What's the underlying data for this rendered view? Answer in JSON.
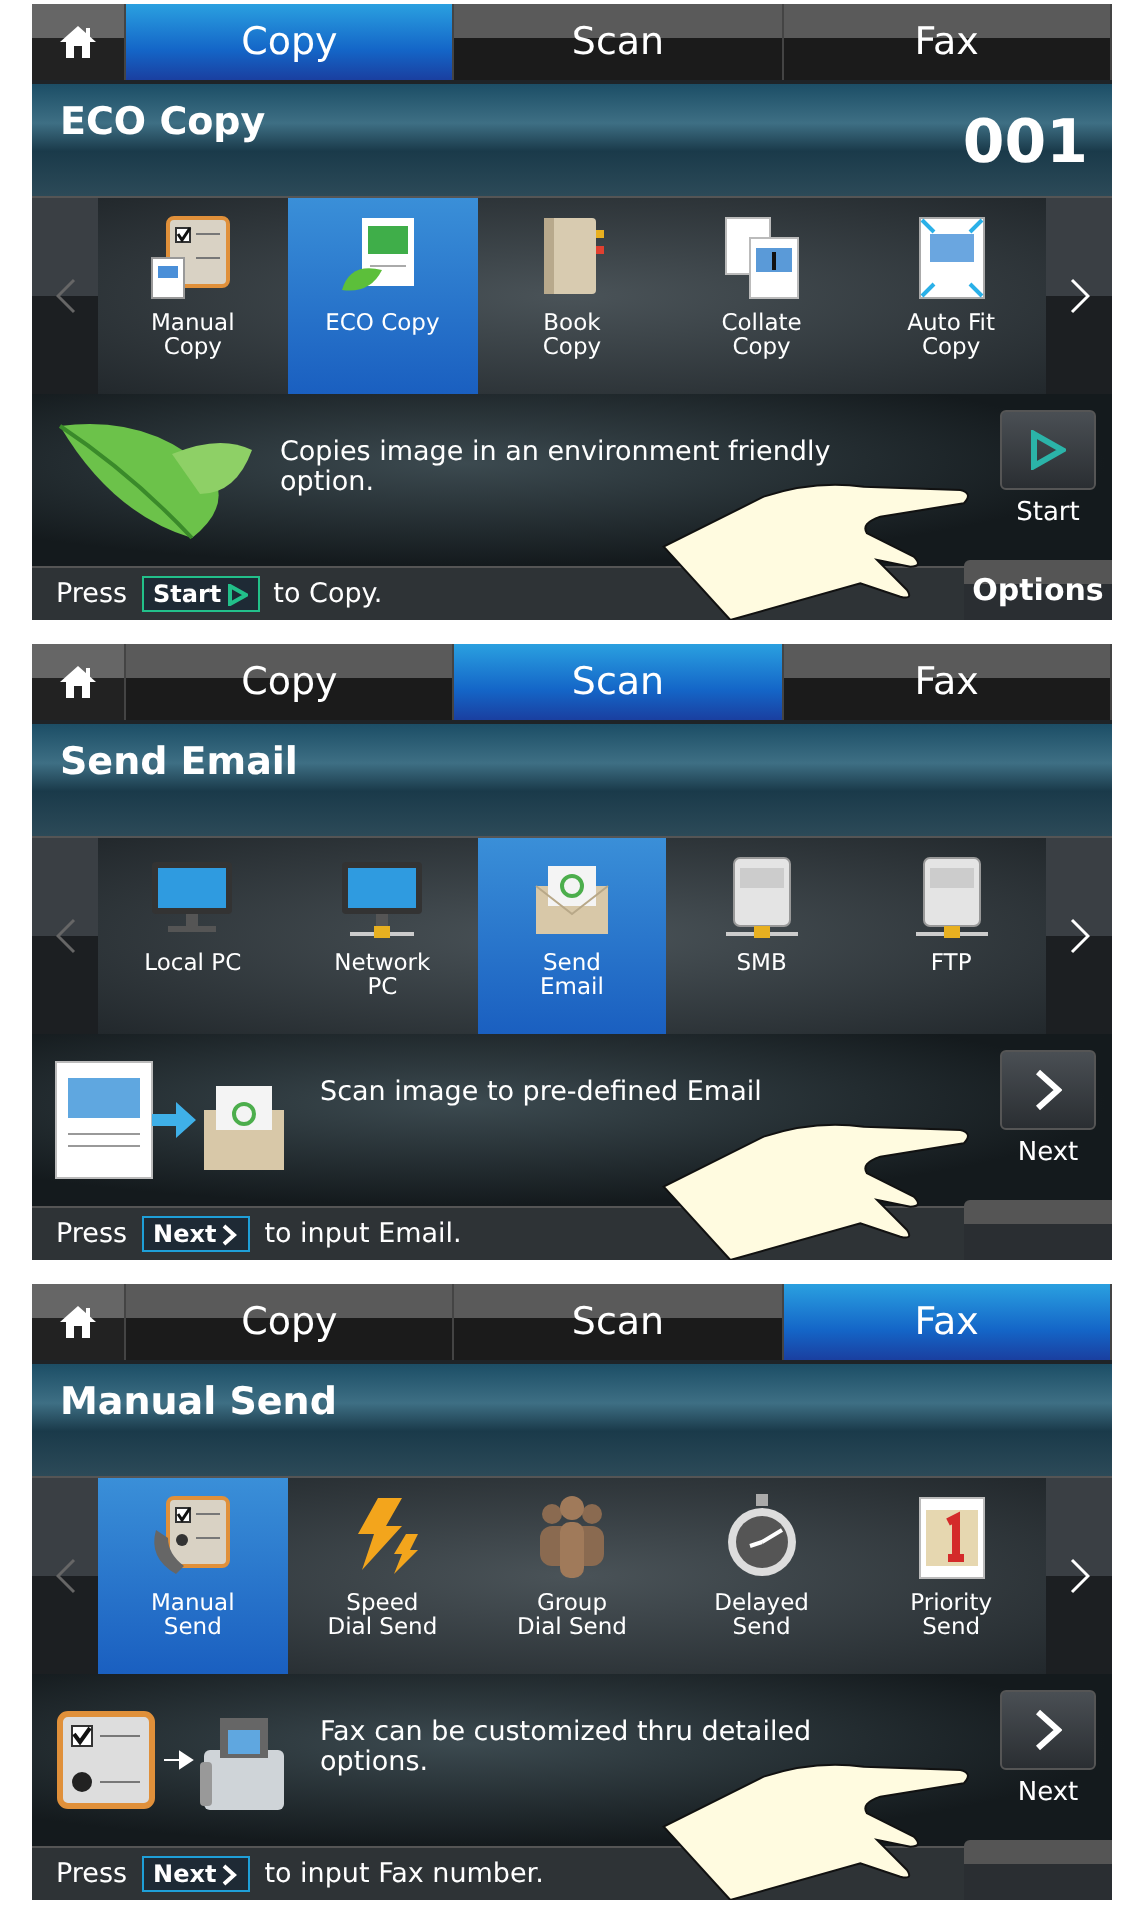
{
  "screens": [
    {
      "tabs": [
        {
          "label": "Copy",
          "selected": true
        },
        {
          "label": "Scan",
          "selected": false
        },
        {
          "label": "Fax",
          "selected": false
        }
      ],
      "title": "ECO Copy",
      "counter": "001",
      "functions": [
        {
          "label": "Manual\nCopy",
          "selected": false
        },
        {
          "label": "ECO Copy",
          "selected": true
        },
        {
          "label": "Book\nCopy",
          "selected": false
        },
        {
          "label": "Collate\nCopy",
          "selected": false
        },
        {
          "label": "Auto Fit\nCopy",
          "selected": false
        }
      ],
      "description": "Copies image in an environment friendly option.",
      "action": {
        "kind": "start",
        "label": "Start"
      },
      "options_button": "Options",
      "footer": {
        "before": "Press",
        "key": {
          "kind": "start",
          "label": "Start"
        },
        "after": "to Copy."
      }
    },
    {
      "tabs": [
        {
          "label": "Copy",
          "selected": false
        },
        {
          "label": "Scan",
          "selected": true
        },
        {
          "label": "Fax",
          "selected": false
        }
      ],
      "title": "Send Email",
      "functions": [
        {
          "label": "Local PC",
          "selected": false
        },
        {
          "label": "Network\nPC",
          "selected": false
        },
        {
          "label": "Send\nEmail",
          "selected": true
        },
        {
          "label": "SMB",
          "selected": false
        },
        {
          "label": "FTP",
          "selected": false
        }
      ],
      "description": "Scan image to pre-defined Email",
      "action": {
        "kind": "next",
        "label": "Next"
      },
      "footer": {
        "before": "Press",
        "key": {
          "kind": "next",
          "label": "Next"
        },
        "after": "to input Email."
      }
    },
    {
      "tabs": [
        {
          "label": "Copy",
          "selected": false
        },
        {
          "label": "Scan",
          "selected": false
        },
        {
          "label": "Fax",
          "selected": true
        }
      ],
      "title": "Manual Send",
      "functions": [
        {
          "label": "Manual\nSend",
          "selected": true
        },
        {
          "label": "Speed\nDial Send",
          "selected": false
        },
        {
          "label": "Group\nDial Send",
          "selected": false
        },
        {
          "label": "Delayed\nSend",
          "selected": false
        },
        {
          "label": "Priority\nSend",
          "selected": false
        }
      ],
      "description": "Fax can be customized thru detailed options.",
      "action": {
        "kind": "next",
        "label": "Next"
      },
      "footer": {
        "before": "Press",
        "key": {
          "kind": "next",
          "label": "Next"
        },
        "after": "to input Fax number."
      }
    }
  ]
}
